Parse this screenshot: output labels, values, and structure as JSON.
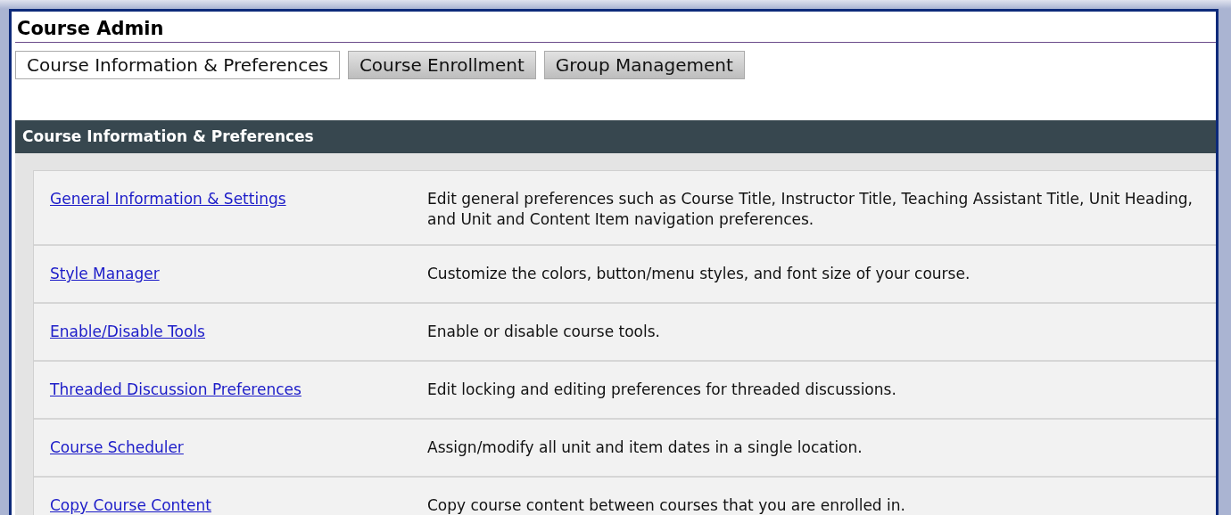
{
  "page_title": "Course Admin",
  "tabs": [
    {
      "label": "Course Information & Preferences",
      "selected": true
    },
    {
      "label": "Course Enrollment",
      "selected": false
    },
    {
      "label": "Group Management",
      "selected": false
    }
  ],
  "section": {
    "title": "Course Information & Preferences",
    "rows": [
      {
        "link": "General Information & Settings",
        "description": "Edit general preferences such as Course Title, Instructor Title, Teaching Assistant Title, Unit Heading, and Unit and Content Item navigation preferences."
      },
      {
        "link": "Style Manager",
        "description": "Customize the colors, button/menu styles, and font size of your course."
      },
      {
        "link": "Enable/Disable Tools",
        "description": "Enable or disable course tools."
      },
      {
        "link": "Threaded Discussion Preferences",
        "description": "Edit locking and editing preferences for threaded discussions."
      },
      {
        "link": "Course Scheduler",
        "description": "Assign/modify all unit and item dates in a single location."
      },
      {
        "link": "Copy Course Content",
        "description": "Copy course content between courses that you are enrolled in."
      }
    ]
  }
}
